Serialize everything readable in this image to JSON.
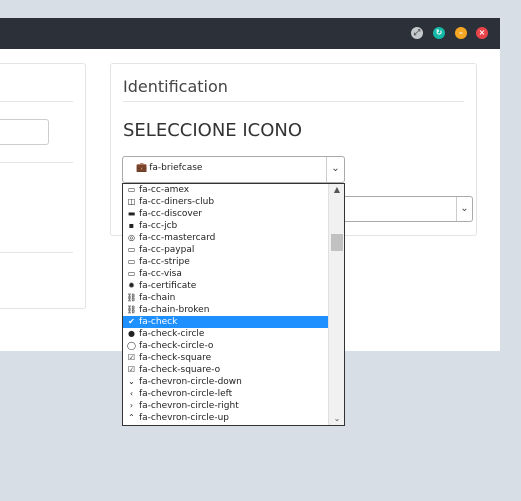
{
  "window": {
    "controls": [
      {
        "name": "expand-icon",
        "glyph": "⤢"
      },
      {
        "name": "refresh-icon",
        "glyph": "↻"
      },
      {
        "name": "minimize-icon",
        "glyph": "–"
      },
      {
        "name": "close-icon",
        "glyph": "×"
      }
    ]
  },
  "panel": {
    "title": "Identification",
    "section_title": "SELECCIONE ICONO"
  },
  "icon_select": {
    "value": "fa-briefcase",
    "value_icon": "briefcase-icon",
    "arrow": "⌄"
  },
  "second_select": {
    "arrow": "⌄"
  },
  "dropdown": {
    "selected_index": 11,
    "options": [
      {
        "label": "fa-cc-amex",
        "glyph": "▭",
        "icon": "cc-amex-icon"
      },
      {
        "label": "fa-cc-diners-club",
        "glyph": "◫",
        "icon": "cc-diners-club-icon"
      },
      {
        "label": "fa-cc-discover",
        "glyph": "▬",
        "icon": "cc-discover-icon"
      },
      {
        "label": "fa-cc-jcb",
        "glyph": "▪",
        "icon": "cc-jcb-icon"
      },
      {
        "label": "fa-cc-mastercard",
        "glyph": "◎",
        "icon": "cc-mastercard-icon"
      },
      {
        "label": "fa-cc-paypal",
        "glyph": "▭",
        "icon": "cc-paypal-icon"
      },
      {
        "label": "fa-cc-stripe",
        "glyph": "▭",
        "icon": "cc-stripe-icon"
      },
      {
        "label": "fa-cc-visa",
        "glyph": "▭",
        "icon": "cc-visa-icon"
      },
      {
        "label": "fa-certificate",
        "glyph": "✹",
        "icon": "certificate-icon"
      },
      {
        "label": "fa-chain",
        "glyph": "⛓",
        "icon": "chain-icon"
      },
      {
        "label": "fa-chain-broken",
        "glyph": "⛓",
        "icon": "chain-broken-icon"
      },
      {
        "label": "fa-check",
        "glyph": "✔",
        "icon": "check-icon"
      },
      {
        "label": "fa-check-circle",
        "glyph": "●",
        "icon": "check-circle-icon"
      },
      {
        "label": "fa-check-circle-o",
        "glyph": "◯",
        "icon": "check-circle-o-icon"
      },
      {
        "label": "fa-check-square",
        "glyph": "☑",
        "icon": "check-square-icon"
      },
      {
        "label": "fa-check-square-o",
        "glyph": "☑",
        "icon": "check-square-o-icon"
      },
      {
        "label": "fa-chevron-circle-down",
        "glyph": "⌄",
        "icon": "chevron-circle-down-icon"
      },
      {
        "label": "fa-chevron-circle-left",
        "glyph": "‹",
        "icon": "chevron-circle-left-icon"
      },
      {
        "label": "fa-chevron-circle-right",
        "glyph": "›",
        "icon": "chevron-circle-right-icon"
      },
      {
        "label": "fa-chevron-circle-up",
        "glyph": "⌃",
        "icon": "chevron-circle-up-icon"
      }
    ]
  },
  "scrollbar": {
    "up": "▲",
    "down": "⌄"
  }
}
